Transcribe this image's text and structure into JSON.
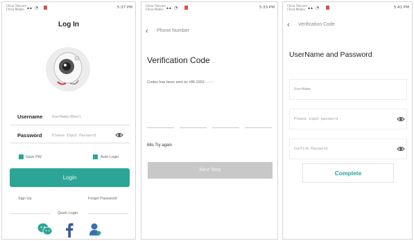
{
  "status": {
    "carrier1": "China Telecom",
    "carrier2": "China Mobile",
    "time_p1": "5:37 PM",
    "time_p2": "5:33 PM",
    "time_p3": "5:41 PM"
  },
  "login": {
    "title": "Log In",
    "username_label": "Username",
    "username_placeholder": "UserName/Email",
    "password_label": "Password",
    "password_placeholder": "Please Input Password",
    "save_pw_label": "Save PW",
    "auto_login_label": "Auto Login",
    "login_button": "Login",
    "sign_up": "Sign Up",
    "forget_password": "Forget Password",
    "quick_login": "Quick Login",
    "icons": [
      "wechat-icon",
      "facebook-icon",
      "user-icon"
    ]
  },
  "verify": {
    "nav_title": "Phone Number",
    "heading": "Verification Code",
    "sent_text": "Codes has been sent to:+86:1562········",
    "retry_text": "68s Try again",
    "next_button": "Next Step"
  },
  "credentials": {
    "nav_title": "Verification Code",
    "heading": "UserName and Password",
    "username_placeholder": "UserName",
    "password_placeholder": "Please input password",
    "confirm_placeholder": "Confirm Password",
    "complete_button": "Complete"
  },
  "colors": {
    "accent": "#2aa596",
    "disabled": "#c8c8c8",
    "facebook": "#3b5998",
    "wechat": "#2aa596"
  }
}
